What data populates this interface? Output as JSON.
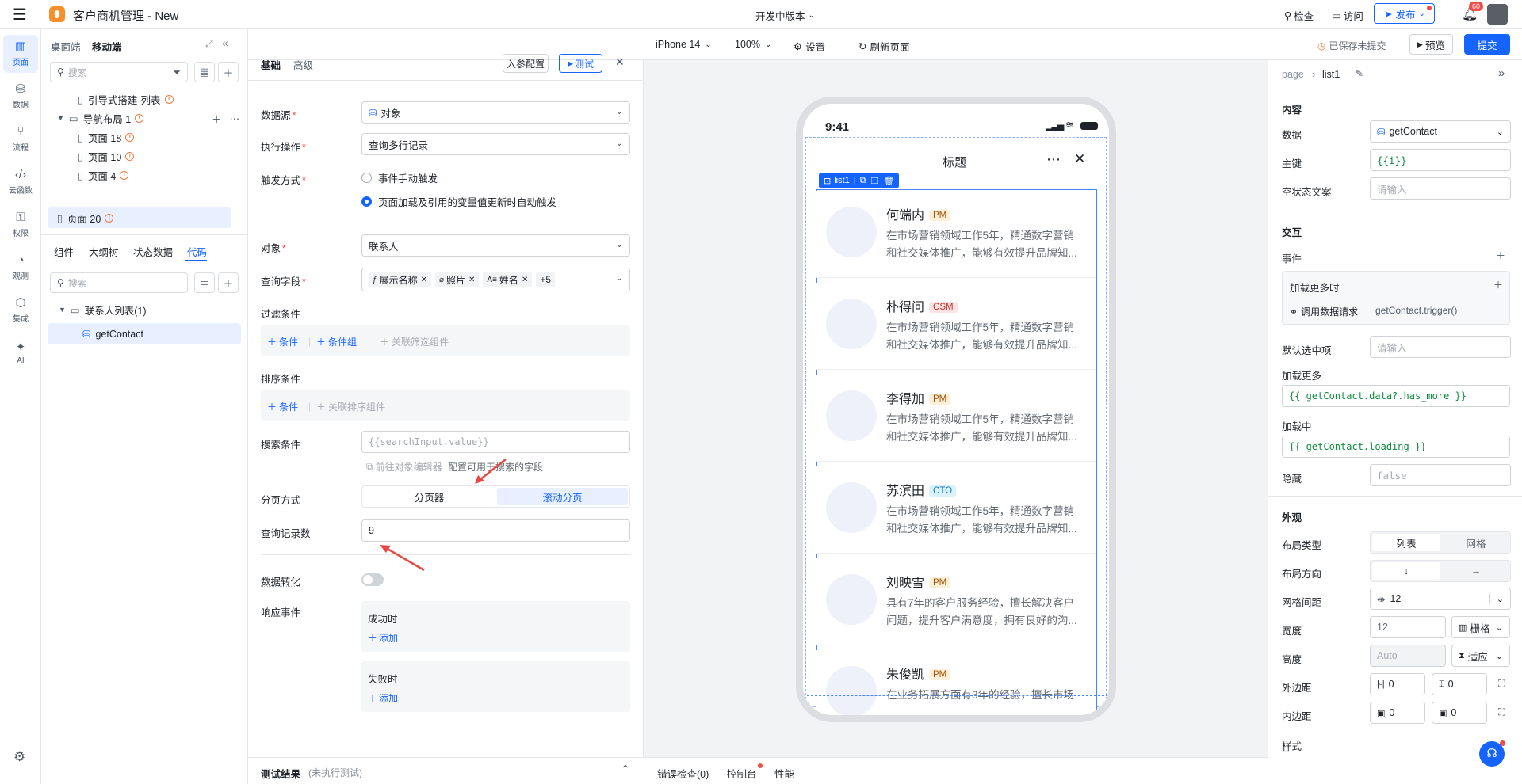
{
  "app": {
    "title": "客户商机管理 - New",
    "version": "开发中版本",
    "check": "检查",
    "visit": "访问",
    "publish": "发布",
    "notif_count": "60"
  },
  "rail": {
    "items": [
      {
        "label": "页面",
        "icon": "page-icon"
      },
      {
        "label": "数据",
        "icon": "database-icon"
      },
      {
        "label": "流程",
        "icon": "flow-icon"
      },
      {
        "label": "云函数",
        "icon": "code-icon"
      },
      {
        "label": "权限",
        "icon": "lock-icon"
      },
      {
        "label": "观测",
        "icon": "monitor-icon"
      },
      {
        "label": "集成",
        "icon": "integration-icon"
      },
      {
        "label": "AI",
        "icon": "sparkle-icon"
      }
    ]
  },
  "tree": {
    "tab_desktop": "桌面端",
    "tab_mobile": "移动端",
    "search_placeholder": "搜索",
    "nodes": [
      "引导式搭建-列表",
      "导航布局 1",
      "页面 18",
      "页面 10",
      "页面 4",
      "页面 20"
    ],
    "tabs": [
      "组件",
      "大纲树",
      "状态数据",
      "代码"
    ],
    "code_search_placeholder": "搜索",
    "code_group": "联系人列表(1)",
    "code_item": "getContact"
  },
  "toolbar": {
    "device": "iPhone 14",
    "zoom": "100%",
    "settings": "设置",
    "refresh": "刷新页面",
    "saved_status": "已保存未提交",
    "preview": "预览",
    "submit": "提交"
  },
  "config": {
    "tab_basic": "基础",
    "tab_advanced": "高级",
    "params_btn": "入参配置",
    "test_btn": "测试",
    "datasource_label": "数据源",
    "datasource_value": "对象",
    "action_label": "执行操作",
    "action_value": "查询多行记录",
    "trigger_label": "触发方式",
    "trigger_manual": "事件手动触发",
    "trigger_auto": "页面加载及引用的变量值更新时自动触发",
    "object_label": "对象",
    "object_value": "联系人",
    "fields_label": "查询字段",
    "fields": [
      "展示名称",
      "照片",
      "姓名"
    ],
    "fields_more": "+5",
    "filter_label": "过滤条件",
    "add_condition": "条件",
    "add_condition_group": "条件组",
    "link_filter": "关联筛选组件",
    "sort_label": "排序条件",
    "link_sort": "关联排序组件",
    "search_label": "搜索条件",
    "search_value": "{{searchInput.value}}",
    "goto_object_editor": "前往对象编辑器",
    "config_search_fields": "配置可用于搜索的字段",
    "paging_label": "分页方式",
    "paging_pager": "分页器",
    "paging_scroll": "滚动分页",
    "count_label": "查询记录数",
    "count_value": "9",
    "transform_label": "数据转化",
    "response_label": "响应事件",
    "on_success": "成功时",
    "on_fail": "失败时",
    "add": "添加"
  },
  "bottom": {
    "test_result": "测试结果",
    "not_run": "(未执行测试)",
    "error_check": "错误检查(0)",
    "console": "控制台",
    "performance": "性能"
  },
  "phone": {
    "time": "9:41",
    "title": "标题",
    "list_tag": "list1",
    "contacts": [
      {
        "name": "何端内",
        "role": "PM",
        "desc1": "在市场营销领域工作5年，精通数字营销",
        "desc2": "和社交媒体推广，能够有效提升品牌知..."
      },
      {
        "name": "朴得问",
        "role": "CSM",
        "desc1": "在市场营销领域工作5年，精通数字营销",
        "desc2": "和社交媒体推广，能够有效提升品牌知..."
      },
      {
        "name": "李得加",
        "role": "PM",
        "desc1": "在市场营销领域工作5年，精通数字营销",
        "desc2": "和社交媒体推广，能够有效提升品牌知..."
      },
      {
        "name": "苏滨田",
        "role": "CTO",
        "desc1": "在市场营销领域工作5年，精通数字营销",
        "desc2": "和社交媒体推广，能够有效提升品牌知..."
      },
      {
        "name": "刘映雪",
        "role": "PM",
        "desc1": "具有7年的客户服务经验，擅长解决客户",
        "desc2": "问题，提升客户满意度，拥有良好的沟..."
      },
      {
        "name": "朱俊凯",
        "role": "PM",
        "desc1": "在业务拓展方面有3年的经验，擅长市场",
        "desc2": ""
      }
    ]
  },
  "props": {
    "crumb_page": "page",
    "crumb_current": "list1",
    "content_title": "内容",
    "data_label": "数据",
    "data_value": "getContact",
    "key_label": "主键",
    "key_value": "{{i}}",
    "empty_label": "空状态文案",
    "empty_placeholder": "请输入",
    "interact_title": "交互",
    "event_label": "事件",
    "load_more_event": "加载更多时",
    "call_request": "调用数据请求",
    "call_value": "getContact.trigger()",
    "default_sel_label": "默认选中项",
    "default_sel_placeholder": "请输入",
    "load_more_label": "加载更多",
    "load_more_value": "{{ getContact.data?.has_more }}",
    "loading_label": "加载中",
    "loading_value": "{{ getContact.loading }}",
    "hidden_label": "隐藏",
    "hidden_value": "false",
    "appearance_title": "外观",
    "layout_type_label": "布局类型",
    "layout_list": "列表",
    "layout_grid": "网格",
    "direction_label": "布局方向",
    "dir_down": "↓",
    "dir_right": "→",
    "gap_label": "网格间距",
    "gap_value": "12",
    "width_label": "宽度",
    "width_value": "12",
    "width_unit": "栅格",
    "height_label": "高度",
    "height_placeholder": "Auto",
    "height_unit": "适应",
    "margin_label": "外边距",
    "margin_a": "0",
    "margin_b": "0",
    "padding_label": "内边距",
    "padding_a": "0",
    "padding_b": "0",
    "style_label": "样式"
  }
}
